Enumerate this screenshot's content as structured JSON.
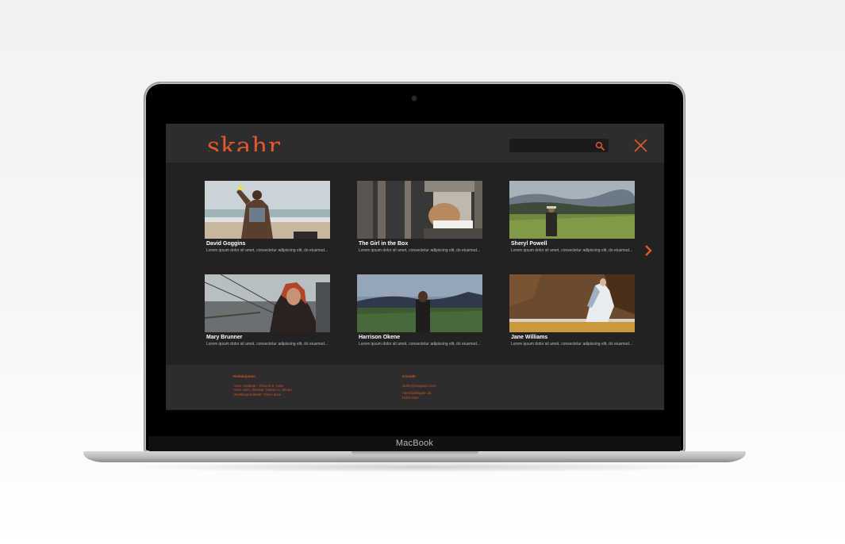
{
  "device": {
    "label": "MacBook"
  },
  "site": {
    "logo": "skahr",
    "search": {
      "placeholder": "",
      "value": ""
    },
    "accent_color": "#e05a2b"
  },
  "cards": [
    {
      "title": "David Goggins",
      "description": "Lorem ipsum dolor sit amet, consectetur adipiscing elit, do eiusmod..."
    },
    {
      "title": "The Girl in the Box",
      "description": "Lorem ipsum dolor sit amet, consectetur adipiscing elit, do eiusmod..."
    },
    {
      "title": "Sheryl Powell",
      "description": "Lorem ipsum dolor sit amet, consectetur adipiscing elit, do eiusmod..."
    },
    {
      "title": "Mary Brunner",
      "description": "Lorem ipsum dolor sit amet, consectetur adipiscing elit, do eiusmod..."
    },
    {
      "title": "Harrison Okene",
      "description": "Lorem ipsum dolor sit amet, consectetur adipiscing elit, do eiusmod..."
    },
    {
      "title": "Jane Williams",
      "description": "Lorem ipsum dolor sit amet, consectetur adipiscing elit, do eiusmod..."
    }
  ],
  "footer": {
    "left": {
      "heading": "Redaksjonen",
      "lines": [
        "Ansv. redaktør : Ostund S. Haw",
        "Ansv. adm. direktør: Marius A. Stinan",
        "Utviklingsredaktør: Tine Lasse"
      ]
    },
    "right": {
      "heading": "Kontakt",
      "lines": [
        "skahr@magasin.com"
      ],
      "address": [
        "Akersbakkgate 18,",
        "0182 Oslo"
      ]
    }
  }
}
